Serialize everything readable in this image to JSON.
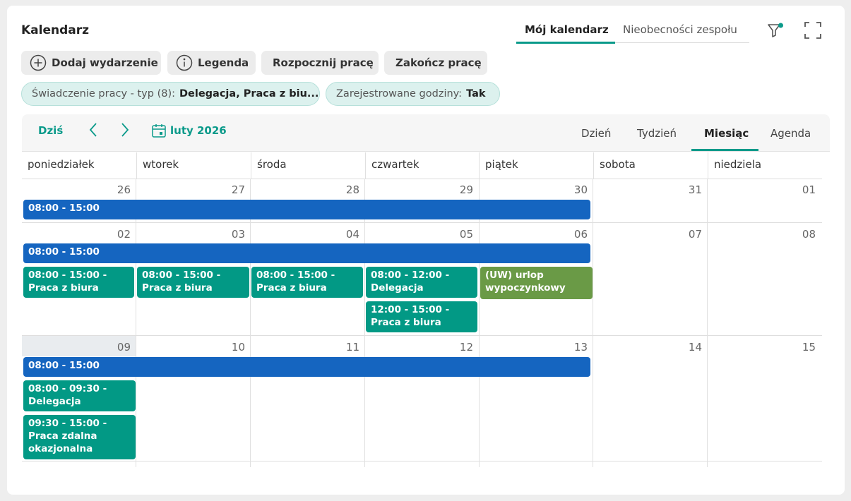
{
  "header": {
    "title": "Kalendarz",
    "tabs": [
      {
        "label": "Mój kalendarz",
        "active": true
      },
      {
        "label": "Nieobecności zespołu",
        "active": false
      }
    ],
    "icons": [
      "filter-icon",
      "fullscreen-icon"
    ]
  },
  "actions": {
    "add_event": "Dodaj wydarzenie",
    "legend": "Legenda",
    "start_work": "Rozpocznij pracę",
    "end_work": "Zakończ pracę"
  },
  "filters": [
    {
      "label": "Świadczenie pracy - typ (8):",
      "value": "Delegacja, Praca z biu..."
    },
    {
      "label": "Zarejestrowane godziny:",
      "value": "Tak"
    }
  ],
  "toolbar": {
    "today": "Dziś",
    "month_label": "luty 2026",
    "views": [
      "Dzień",
      "Tydzień",
      "Miesiąc",
      "Agenda"
    ],
    "active_view": "Miesiąc"
  },
  "weekdays": [
    "poniedziałek",
    "wtorek",
    "środa",
    "czwartek",
    "piątek",
    "sobota",
    "niedziela"
  ],
  "weeks": [
    {
      "days": [
        "26",
        "27",
        "28",
        "29",
        "30",
        "31",
        "01"
      ]
    },
    {
      "days": [
        "02",
        "03",
        "04",
        "05",
        "06",
        "07",
        "08"
      ]
    },
    {
      "days": [
        "09",
        "10",
        "11",
        "12",
        "13",
        "14",
        "15"
      ]
    }
  ],
  "events": {
    "w1_span": "08:00 - 15:00",
    "w2_span": "08:00 - 15:00",
    "w2_mon": "08:00 - 15:00 - Praca z biura",
    "w2_tue": "08:00 - 15:00 - Praca z biura",
    "w2_wed": "08:00 - 15:00 - Praca z biura",
    "w2_thu_1": "08:00 - 12:00 - Delegacja",
    "w2_thu_2": "12:00 - 15:00 - Praca z biura",
    "w2_fri": "(UW) urlop wypoczynkowy",
    "w3_span": "08:00 - 15:00",
    "w3_mon_1": "08:00 - 09:30 - Delegacja",
    "w3_mon_2": "09:30 - 15:00 - Praca zdalna okazjonalna"
  },
  "colors": {
    "accent": "#0a9a8a",
    "event_blue": "#1565c0",
    "event_teal": "#029985",
    "event_green": "#6a9a46"
  }
}
